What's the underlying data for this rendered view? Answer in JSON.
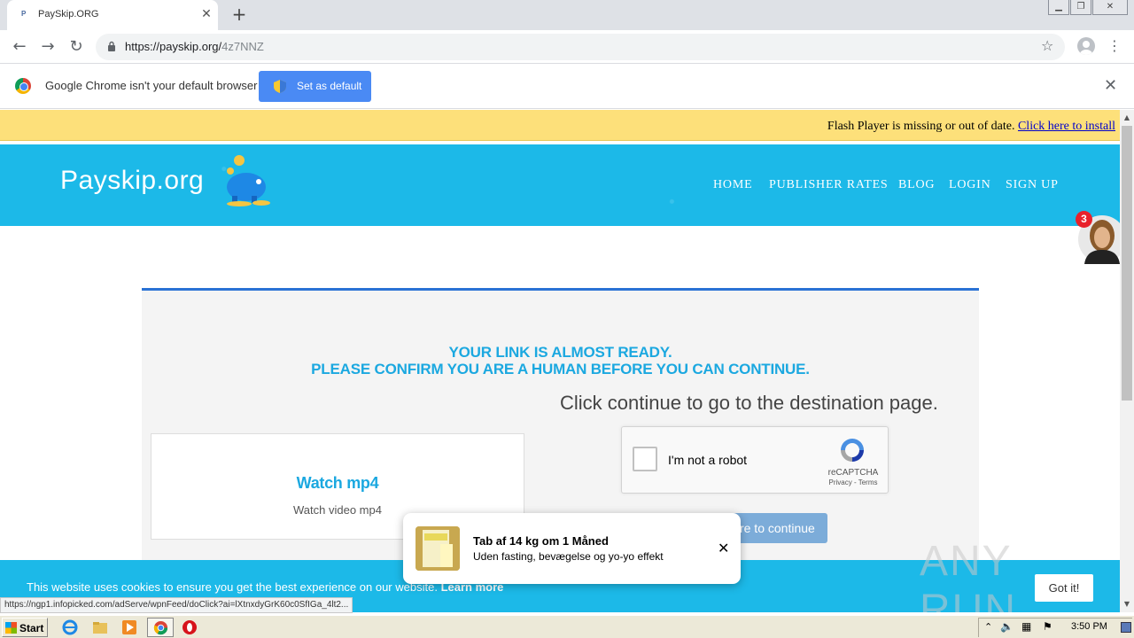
{
  "browser": {
    "tab_title": "PaySkip.ORG",
    "tab_favicon": "P",
    "new_tab_icon": "+",
    "url_host": "https://payskip.org/",
    "url_path": "4z7NNZ",
    "infobar_text": "Google Chrome isn't your default browser",
    "set_default_label": "Set as default",
    "status_url": "https://ngp1.infopicked.com/adServe/wpnFeed/doClick?ai=lXtnxdyGrK60c0SfIGa_4lt2..."
  },
  "flash": {
    "message": "Flash Player is missing or out of date.",
    "link": "Click here to install"
  },
  "site": {
    "logo": "Payskip.org",
    "nav": [
      "HOME",
      "PUBLISHER RATES",
      "BLOG",
      "LOGIN",
      "SIGN UP"
    ],
    "chat_badge": "3"
  },
  "card": {
    "headline_1": "YOUR LINK IS ALMOST READY.",
    "headline_2": "PLEASE CONFIRM YOU ARE A HUMAN BEFORE YOU CAN CONTINUE.",
    "subhead": "Click continue to go to the destination page.",
    "watch_title": "Watch mp4",
    "watch_sub": "Watch video mp4",
    "continue_label": "Click here to continue"
  },
  "recaptcha": {
    "label": "I'm not a robot",
    "brand": "reCAPTCHA",
    "terms": "Privacy - Terms"
  },
  "ad": {
    "title": "Tab af 14 kg om 1 Måned",
    "subtitle": "Uden fasting, bevægelse og yo-yo effekt"
  },
  "cookie": {
    "text": "This website uses cookies to ensure you get the best experience on our website.",
    "learn_more": "Learn more",
    "got_it": "Got it!"
  },
  "watermark": "ANY RUN",
  "taskbar": {
    "start_label": "Start",
    "clock": "3:50 PM"
  }
}
